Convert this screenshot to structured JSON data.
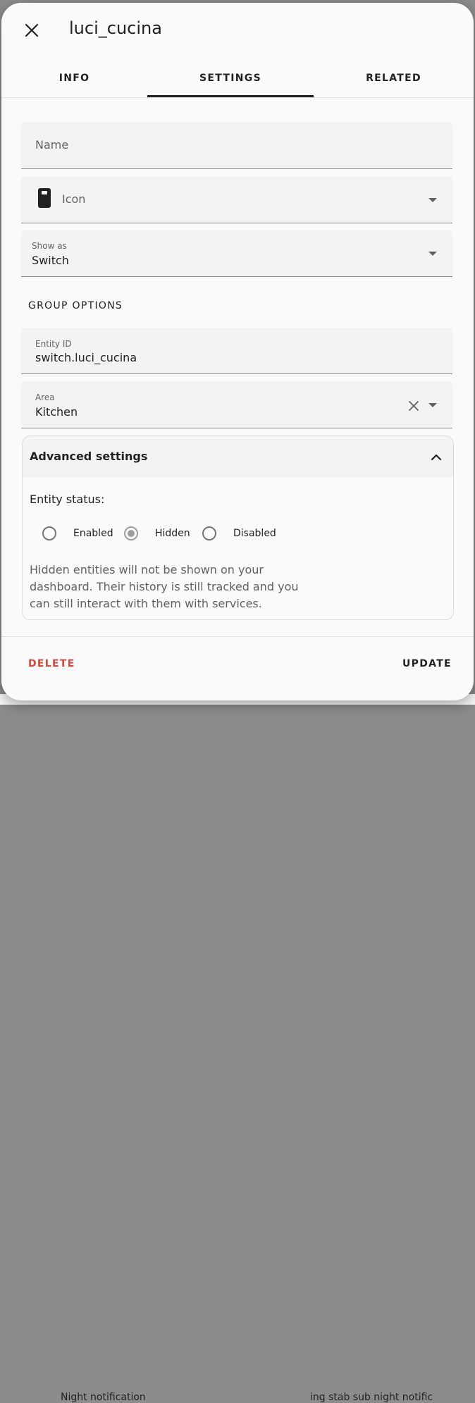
{
  "dialog": {
    "title": "luci_cucina",
    "close_icon": "close-icon"
  },
  "tabs": [
    {
      "label": "INFO",
      "active": false
    },
    {
      "label": "SETTINGS",
      "active": true
    },
    {
      "label": "RELATED",
      "active": false
    }
  ],
  "settings": {
    "name_field": {
      "label": "Name",
      "value": ""
    },
    "icon_field": {
      "label": "Icon",
      "icon": "light-switch-icon"
    },
    "show_as_field": {
      "label": "Show as",
      "value": "Switch"
    },
    "group_options_heading": "GROUP OPTIONS",
    "entity_id_field": {
      "label": "Entity ID",
      "value": "switch.luci_cucina"
    },
    "area_field": {
      "label": "Area",
      "value": "Kitchen"
    }
  },
  "advanced": {
    "title": "Advanced settings",
    "status_label": "Entity status:",
    "options": [
      {
        "label": "Enabled",
        "checked": false
      },
      {
        "label": "Hidden",
        "checked": true
      },
      {
        "label": "Disabled",
        "checked": false
      }
    ],
    "help_text": "Hidden entities will not be shown on your dashboard. Their history is still tracked and you can still interact with them with services."
  },
  "footer": {
    "delete_label": "DELETE",
    "update_label": "UPDATE"
  },
  "background": {
    "partial_text_left": "Night notification",
    "partial_text_right": "ing stab sub night notific"
  },
  "colors": {
    "delete": "#db4437",
    "accent": "#212121"
  }
}
